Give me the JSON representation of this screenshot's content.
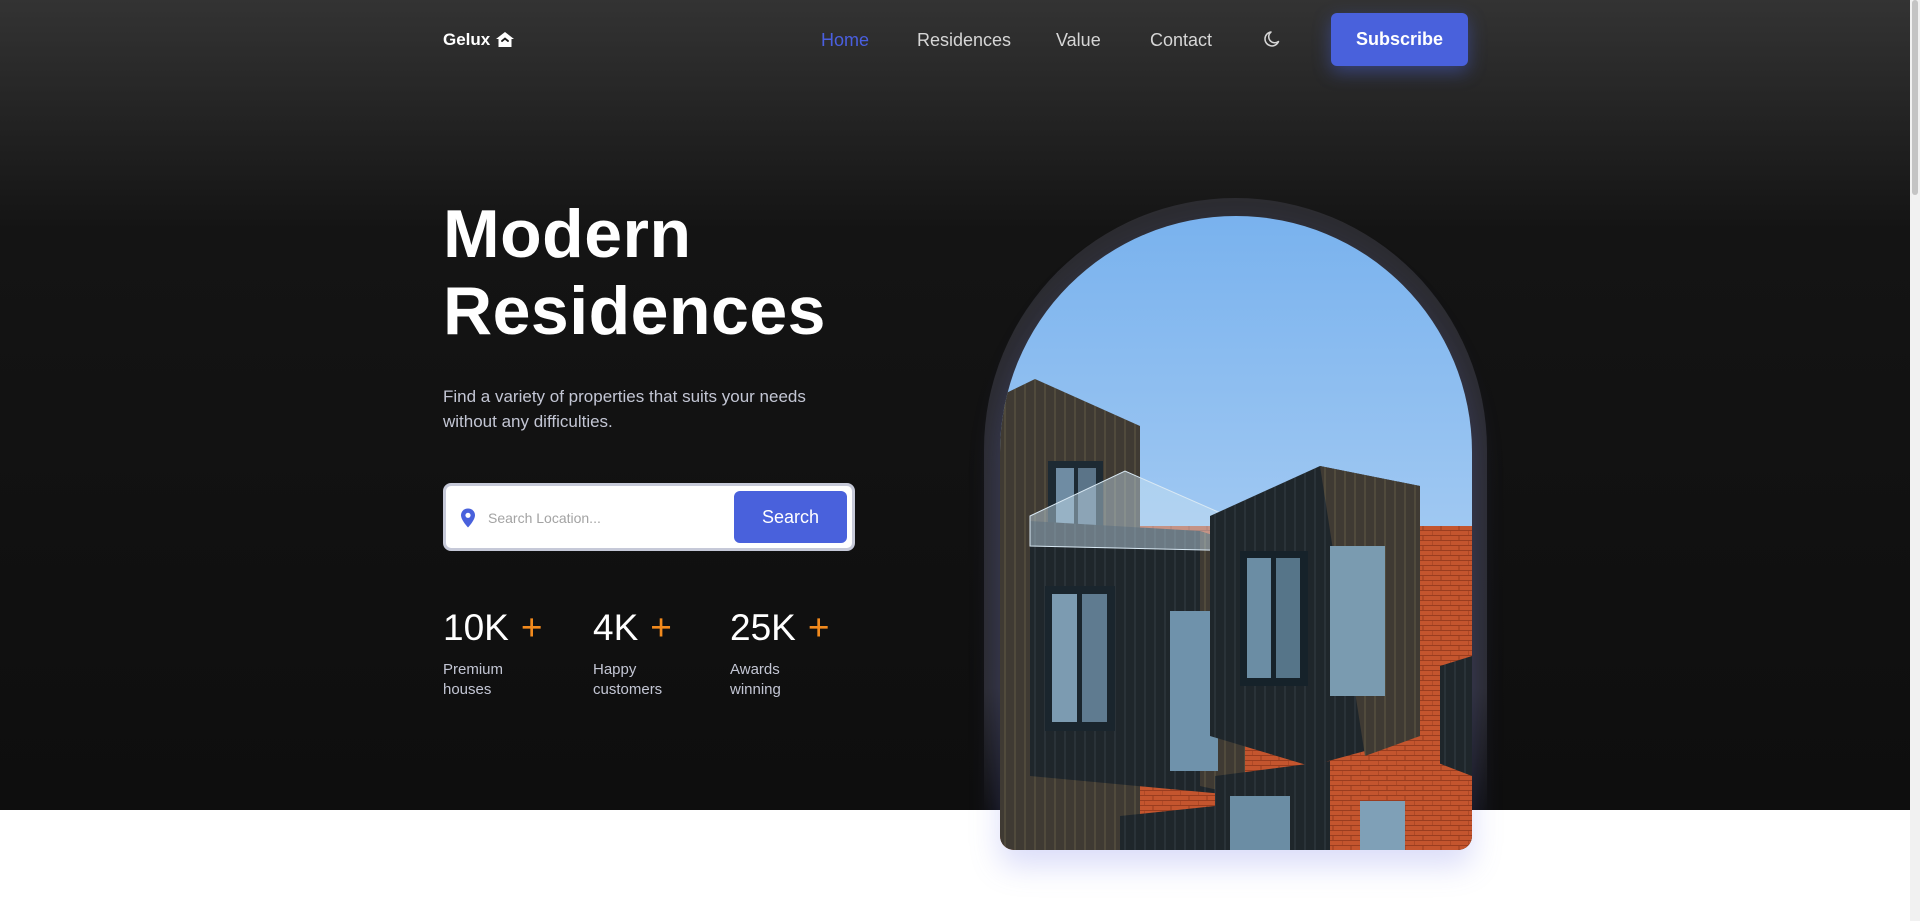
{
  "header": {
    "logo_text": "Gelux",
    "logo_icon": "home-icon",
    "nav": [
      {
        "label": "Home",
        "active": true
      },
      {
        "label": "Residences",
        "active": false
      },
      {
        "label": "Value",
        "active": false
      },
      {
        "label": "Contact",
        "active": false
      }
    ],
    "theme_icon": "moon-icon",
    "subscribe_label": "Subscribe"
  },
  "hero": {
    "title_line1": "Modern",
    "title_line2": "Residences",
    "subtitle_line1": "Find a variety of properties that suits your needs",
    "subtitle_line2": "without any difficulties.",
    "search": {
      "icon": "location-pin-icon",
      "placeholder": "Search Location...",
      "value": "",
      "button_label": "Search"
    },
    "stats": [
      {
        "value": "10K",
        "plus": "+",
        "label_line1": "Premium",
        "label_line2": "houses"
      },
      {
        "value": "4K",
        "plus": "+",
        "label_line1": "Happy",
        "label_line2": "customers"
      },
      {
        "value": "25K",
        "plus": "+",
        "label_line1": "Awards",
        "label_line2": "winning"
      }
    ],
    "image": "modern-apartment-building-photo"
  },
  "colors": {
    "accent": "#4961dc",
    "plus": "#f28a1d",
    "background": "#0e0e0e"
  }
}
